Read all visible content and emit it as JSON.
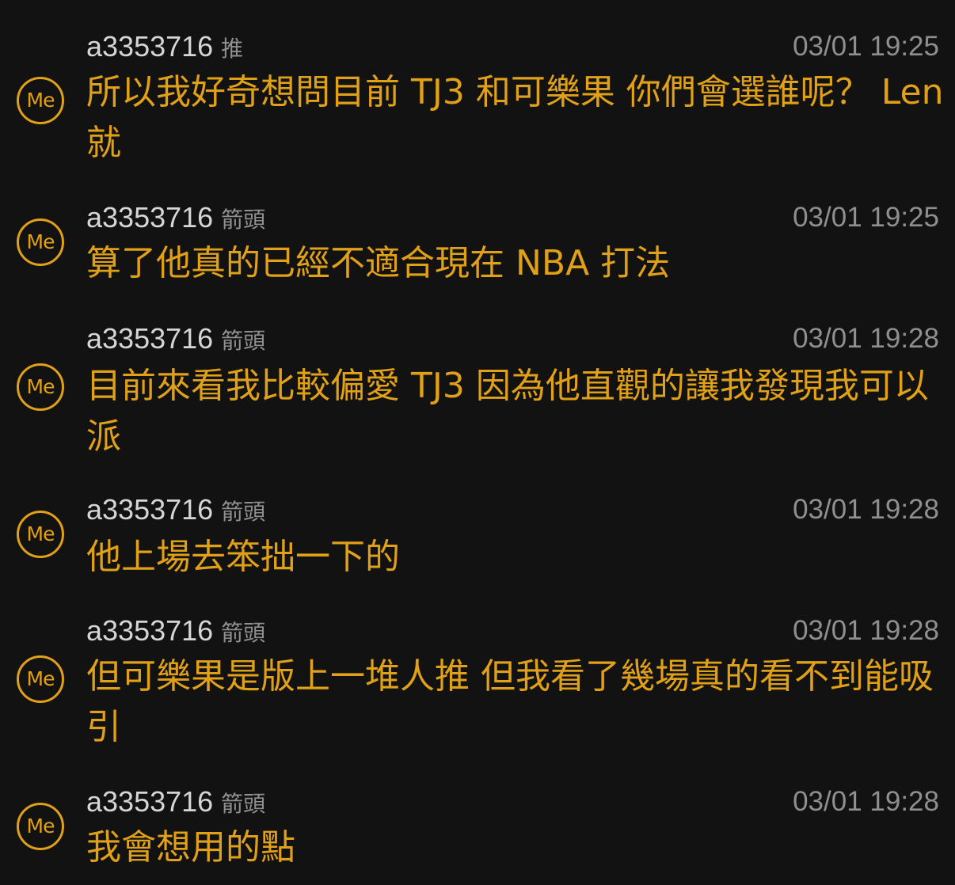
{
  "colors": {
    "background": "#121212",
    "accent": "#e0a017",
    "username": "#d6d6d6",
    "meta": "#8f8f8f"
  },
  "comments": [
    {
      "avatar_text": "Me",
      "user": "a3353716",
      "tag": "推",
      "time": "03/01 19:25",
      "text": "所以我好奇想問目前 TJ3 和可樂果 你們會選誰呢？ Len就"
    },
    {
      "avatar_text": "Me",
      "user": "a3353716",
      "tag": "箭頭",
      "time": "03/01 19:25",
      "text": "算了他真的已經不適合現在 NBA 打法"
    },
    {
      "avatar_text": "Me",
      "user": "a3353716",
      "tag": "箭頭",
      "time": "03/01 19:28",
      "text": "目前來看我比較偏愛 TJ3 因為他直觀的讓我發現我可以派"
    },
    {
      "avatar_text": "Me",
      "user": "a3353716",
      "tag": "箭頭",
      "time": "03/01 19:28",
      "text": "他上場去笨拙一下的"
    },
    {
      "avatar_text": "Me",
      "user": "a3353716",
      "tag": "箭頭",
      "time": "03/01 19:28",
      "text": "但可樂果是版上一堆人推 但我看了幾場真的看不到能吸引"
    },
    {
      "avatar_text": "Me",
      "user": "a3353716",
      "tag": "箭頭",
      "time": "03/01 19:28",
      "text": "我會想用的點"
    }
  ]
}
